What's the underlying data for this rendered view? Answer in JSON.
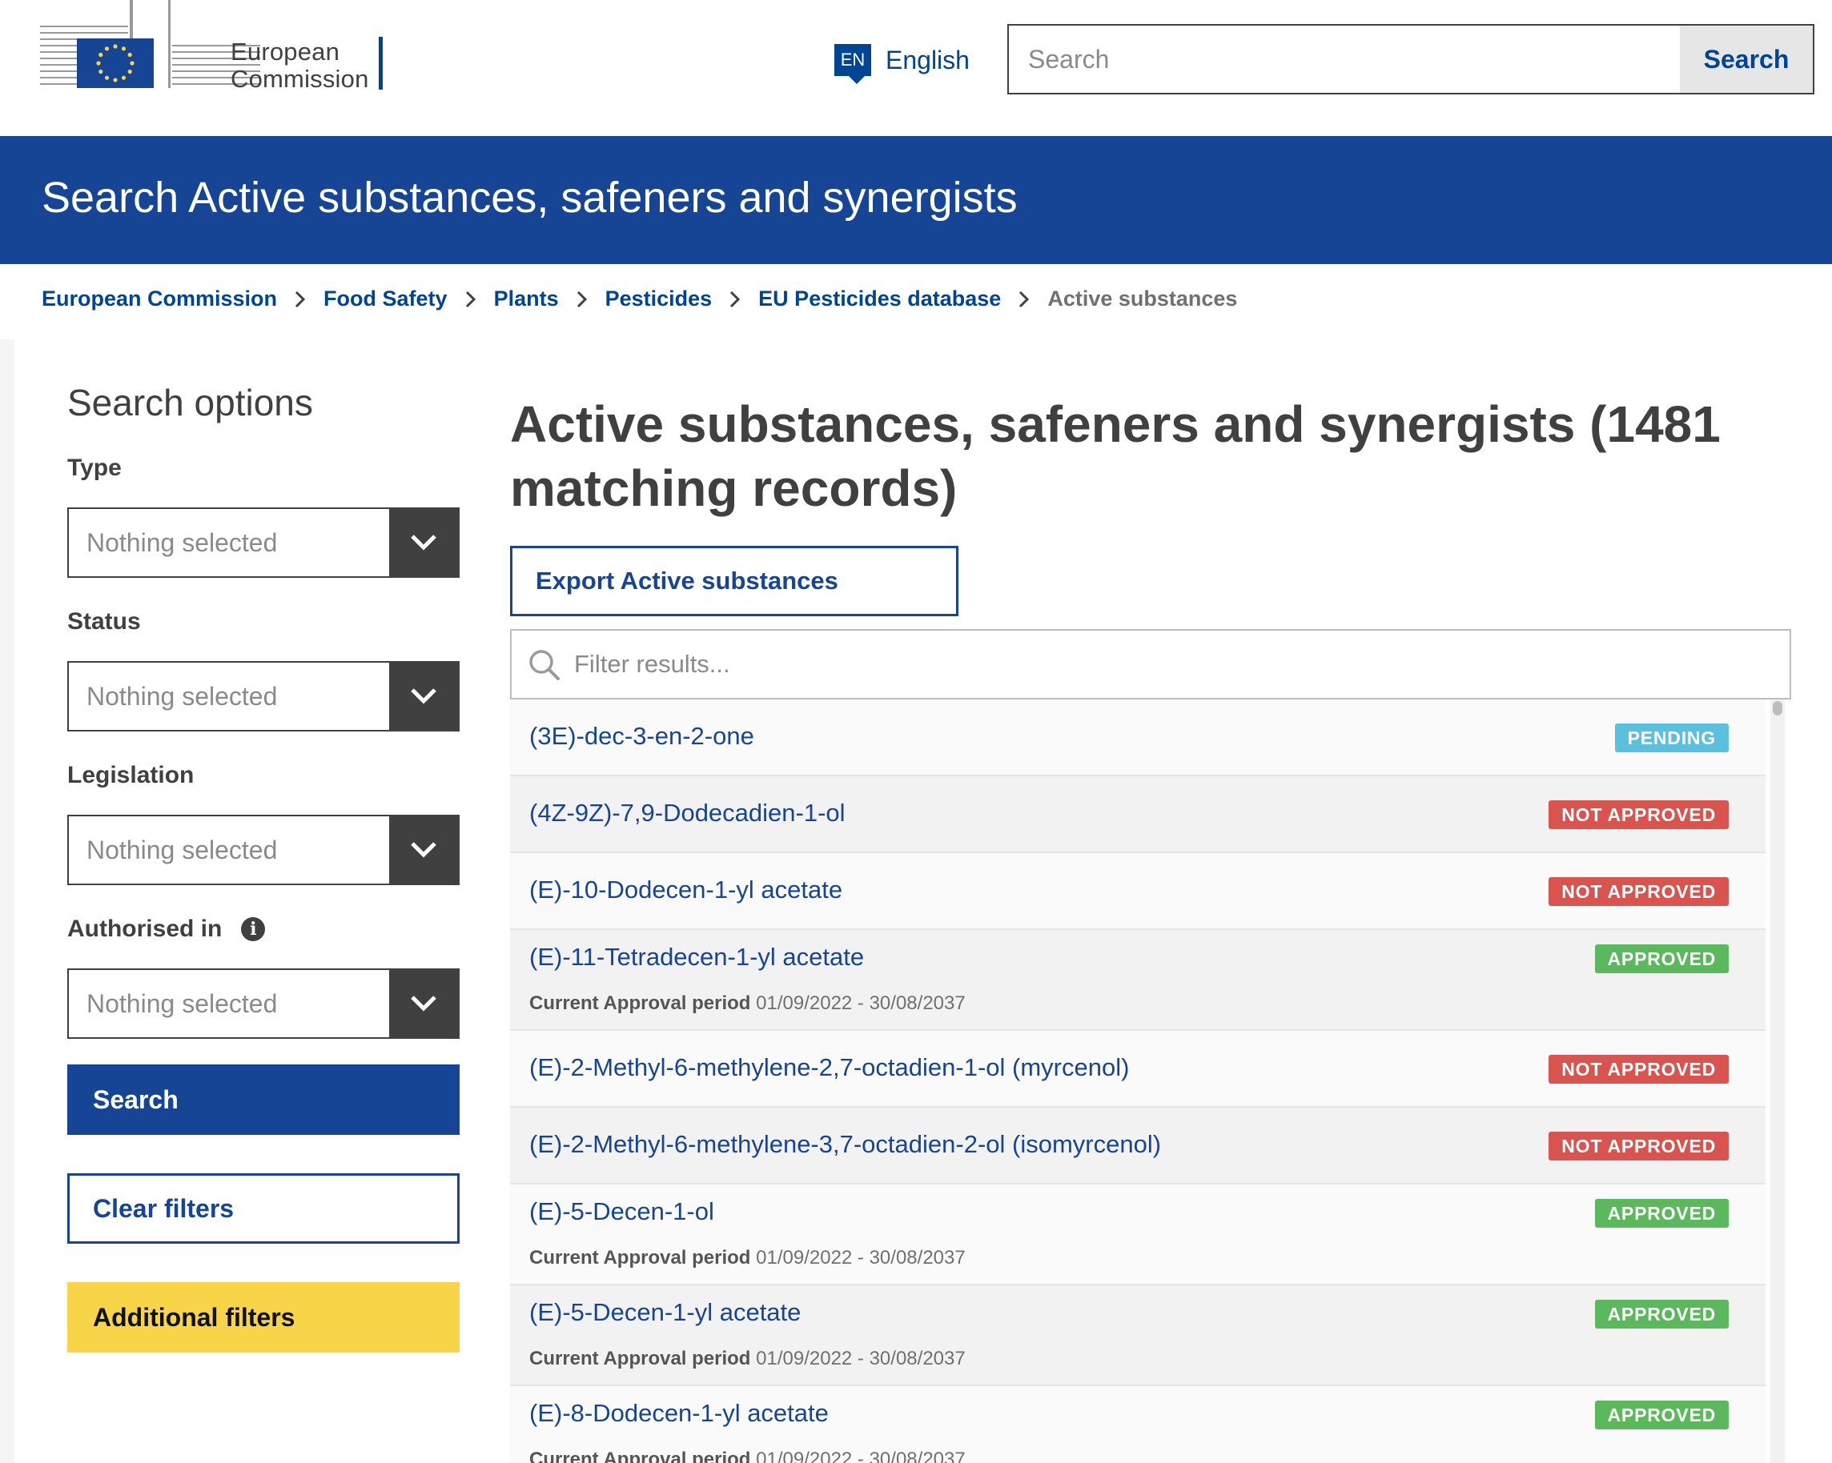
{
  "header": {
    "logo_text_line1": "European",
    "logo_text_line2": "Commission",
    "language_code": "EN",
    "language_label": "English",
    "search_placeholder": "Search",
    "search_button": "Search"
  },
  "page_title": "Search Active substances, safeners and synergists",
  "breadcrumb": [
    "European Commission",
    "Food Safety",
    "Plants",
    "Pesticides",
    "EU Pesticides database",
    "Active substances"
  ],
  "sidebar": {
    "heading": "Search options",
    "filters": [
      {
        "label": "Type",
        "value": "Nothing selected"
      },
      {
        "label": "Status",
        "value": "Nothing selected"
      },
      {
        "label": "Legislation",
        "value": "Nothing selected"
      },
      {
        "label": "Authorised in",
        "value": "Nothing selected"
      }
    ],
    "search_button": "Search",
    "clear_button": "Clear filters",
    "additional_button": "Additional filters"
  },
  "main": {
    "title": "Active substances, safeners and synergists (1481 matching records)",
    "export_button": "Export Active substances",
    "filter_placeholder": "Filter results...",
    "period_label": "Current Approval period",
    "results": [
      {
        "name": "(3E)-dec-3-en-2-one",
        "status": "PENDING",
        "period": ""
      },
      {
        "name": "(4Z-9Z)-7,9-Dodecadien-1-ol",
        "status": "NOT APPROVED",
        "period": ""
      },
      {
        "name": "(E)-10-Dodecen-1-yl acetate",
        "status": "NOT APPROVED",
        "period": ""
      },
      {
        "name": "(E)-11-Tetradecen-1-yl acetate",
        "status": "APPROVED",
        "period": "01/09/2022 - 30/08/2037"
      },
      {
        "name": "(E)-2-Methyl-6-methylene-2,7-octadien-1-ol (myrcenol)",
        "status": "NOT APPROVED",
        "period": ""
      },
      {
        "name": "(E)-2-Methyl-6-methylene-3,7-octadien-2-ol (isomyrcenol)",
        "status": "NOT APPROVED",
        "period": ""
      },
      {
        "name": "(E)-5-Decen-1-ol",
        "status": "APPROVED",
        "period": "01/09/2022 - 30/08/2037"
      },
      {
        "name": "(E)-5-Decen-1-yl acetate",
        "status": "APPROVED",
        "period": "01/09/2022 - 30/08/2037"
      },
      {
        "name": "(E)-8-Dodecen-1-yl acetate",
        "status": "APPROVED",
        "period": "01/09/2022 - 30/08/2037"
      }
    ]
  },
  "colors": {
    "brand_blue": "#164595",
    "link_blue": "#004494",
    "pending": "#5bc0de",
    "not_approved": "#d9534f",
    "approved": "#5cb85c",
    "yellow": "#f8d548"
  }
}
